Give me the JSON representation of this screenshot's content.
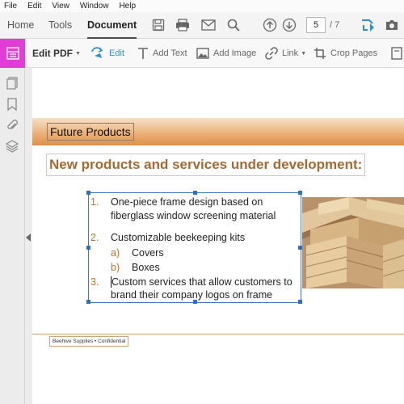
{
  "menu": [
    "File",
    "Edit",
    "View",
    "Window",
    "Help"
  ],
  "tabs": {
    "home": "Home",
    "tools": "Tools",
    "document": "Document"
  },
  "nav": {
    "page_current": "5",
    "page_total": "/ 7"
  },
  "edit_toolbar": {
    "edit_pdf": "Edit PDF",
    "edit": "Edit",
    "add_text": "Add Text",
    "add_image": "Add Image",
    "link": "Link",
    "crop_pages": "Crop Pages"
  },
  "colors": {
    "accent_magenta": "#e33bd8",
    "selection_blue": "#3c78c8",
    "heading_brown": "#a56a32",
    "banner_orange": "#dc8f48"
  },
  "document": {
    "banner_title": "Future Products",
    "headline": "New products and services under development:",
    "list": {
      "n1": "1.",
      "item1_line1": "One-piece frame design based on",
      "item1_line2": "fiberglass window screening material",
      "n2": "2.",
      "item2": "Customizable beekeeping kits",
      "na": "a)",
      "sub_a": "Covers",
      "nb": "b)",
      "sub_b": "Boxes",
      "n3": "3.",
      "item3_line1": "Custom services that allow customers to",
      "item3_line2": "brand their company logos on frame"
    },
    "footer": "Beehive Supplies  •  Confidential"
  }
}
